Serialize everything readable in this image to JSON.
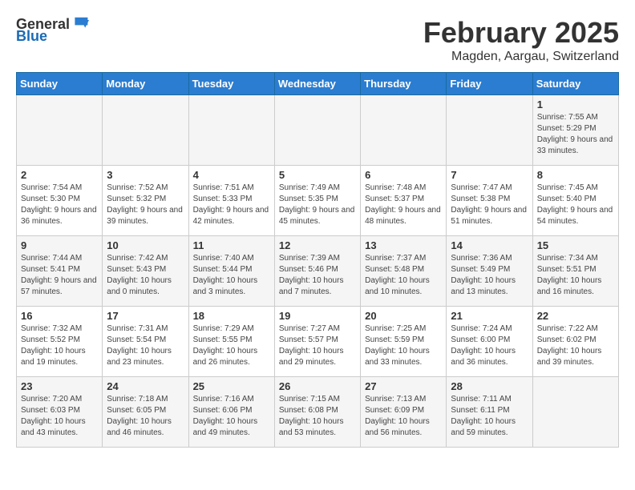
{
  "logo": {
    "general": "General",
    "blue": "Blue"
  },
  "title": "February 2025",
  "subtitle": "Magden, Aargau, Switzerland",
  "headers": [
    "Sunday",
    "Monday",
    "Tuesday",
    "Wednesday",
    "Thursday",
    "Friday",
    "Saturday"
  ],
  "weeks": [
    [
      {
        "day": "",
        "info": ""
      },
      {
        "day": "",
        "info": ""
      },
      {
        "day": "",
        "info": ""
      },
      {
        "day": "",
        "info": ""
      },
      {
        "day": "",
        "info": ""
      },
      {
        "day": "",
        "info": ""
      },
      {
        "day": "1",
        "info": "Sunrise: 7:55 AM\nSunset: 5:29 PM\nDaylight: 9 hours and 33 minutes."
      }
    ],
    [
      {
        "day": "2",
        "info": "Sunrise: 7:54 AM\nSunset: 5:30 PM\nDaylight: 9 hours and 36 minutes."
      },
      {
        "day": "3",
        "info": "Sunrise: 7:52 AM\nSunset: 5:32 PM\nDaylight: 9 hours and 39 minutes."
      },
      {
        "day": "4",
        "info": "Sunrise: 7:51 AM\nSunset: 5:33 PM\nDaylight: 9 hours and 42 minutes."
      },
      {
        "day": "5",
        "info": "Sunrise: 7:49 AM\nSunset: 5:35 PM\nDaylight: 9 hours and 45 minutes."
      },
      {
        "day": "6",
        "info": "Sunrise: 7:48 AM\nSunset: 5:37 PM\nDaylight: 9 hours and 48 minutes."
      },
      {
        "day": "7",
        "info": "Sunrise: 7:47 AM\nSunset: 5:38 PM\nDaylight: 9 hours and 51 minutes."
      },
      {
        "day": "8",
        "info": "Sunrise: 7:45 AM\nSunset: 5:40 PM\nDaylight: 9 hours and 54 minutes."
      }
    ],
    [
      {
        "day": "9",
        "info": "Sunrise: 7:44 AM\nSunset: 5:41 PM\nDaylight: 9 hours and 57 minutes."
      },
      {
        "day": "10",
        "info": "Sunrise: 7:42 AM\nSunset: 5:43 PM\nDaylight: 10 hours and 0 minutes."
      },
      {
        "day": "11",
        "info": "Sunrise: 7:40 AM\nSunset: 5:44 PM\nDaylight: 10 hours and 3 minutes."
      },
      {
        "day": "12",
        "info": "Sunrise: 7:39 AM\nSunset: 5:46 PM\nDaylight: 10 hours and 7 minutes."
      },
      {
        "day": "13",
        "info": "Sunrise: 7:37 AM\nSunset: 5:48 PM\nDaylight: 10 hours and 10 minutes."
      },
      {
        "day": "14",
        "info": "Sunrise: 7:36 AM\nSunset: 5:49 PM\nDaylight: 10 hours and 13 minutes."
      },
      {
        "day": "15",
        "info": "Sunrise: 7:34 AM\nSunset: 5:51 PM\nDaylight: 10 hours and 16 minutes."
      }
    ],
    [
      {
        "day": "16",
        "info": "Sunrise: 7:32 AM\nSunset: 5:52 PM\nDaylight: 10 hours and 19 minutes."
      },
      {
        "day": "17",
        "info": "Sunrise: 7:31 AM\nSunset: 5:54 PM\nDaylight: 10 hours and 23 minutes."
      },
      {
        "day": "18",
        "info": "Sunrise: 7:29 AM\nSunset: 5:55 PM\nDaylight: 10 hours and 26 minutes."
      },
      {
        "day": "19",
        "info": "Sunrise: 7:27 AM\nSunset: 5:57 PM\nDaylight: 10 hours and 29 minutes."
      },
      {
        "day": "20",
        "info": "Sunrise: 7:25 AM\nSunset: 5:59 PM\nDaylight: 10 hours and 33 minutes."
      },
      {
        "day": "21",
        "info": "Sunrise: 7:24 AM\nSunset: 6:00 PM\nDaylight: 10 hours and 36 minutes."
      },
      {
        "day": "22",
        "info": "Sunrise: 7:22 AM\nSunset: 6:02 PM\nDaylight: 10 hours and 39 minutes."
      }
    ],
    [
      {
        "day": "23",
        "info": "Sunrise: 7:20 AM\nSunset: 6:03 PM\nDaylight: 10 hours and 43 minutes."
      },
      {
        "day": "24",
        "info": "Sunrise: 7:18 AM\nSunset: 6:05 PM\nDaylight: 10 hours and 46 minutes."
      },
      {
        "day": "25",
        "info": "Sunrise: 7:16 AM\nSunset: 6:06 PM\nDaylight: 10 hours and 49 minutes."
      },
      {
        "day": "26",
        "info": "Sunrise: 7:15 AM\nSunset: 6:08 PM\nDaylight: 10 hours and 53 minutes."
      },
      {
        "day": "27",
        "info": "Sunrise: 7:13 AM\nSunset: 6:09 PM\nDaylight: 10 hours and 56 minutes."
      },
      {
        "day": "28",
        "info": "Sunrise: 7:11 AM\nSunset: 6:11 PM\nDaylight: 10 hours and 59 minutes."
      },
      {
        "day": "",
        "info": ""
      }
    ]
  ]
}
